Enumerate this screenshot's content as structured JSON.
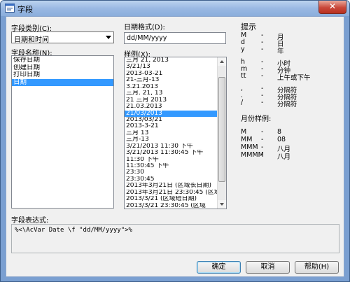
{
  "window": {
    "title": "字段",
    "close_glyph": "✕"
  },
  "category": {
    "label": "字段类别(C):",
    "value": "日期和时间"
  },
  "names": {
    "label": "字段名称(N):",
    "items": [
      "保存日期",
      "创建日期",
      "打印日期",
      "日期"
    ],
    "selected_index": 3
  },
  "format": {
    "label": "日期格式(D):",
    "value": "dd/MM/yyyy"
  },
  "samples": {
    "label": "样例(X):",
    "items": [
      "三月 21, 2013",
      "3/21/13",
      "2013-03-21",
      "21-三月-13",
      "3.21.2013",
      "三月. 21, 13",
      "21 三月 2013",
      "21.03.2013",
      "21/03/2013",
      "2013/03/21",
      "2013-3-21",
      "三月 13",
      "三月-13",
      "3/21/2013 11:30 下午",
      "3/21/2013 11:30:45 下午",
      "11:30 下午",
      "11:30:45 下午",
      "23:30",
      "23:30:45",
      "2013年3月21日 (区域长日期)",
      "2013年3月21日 23:30:45 (区域",
      "2013/3/21 (区域短日期)",
      "2013/3/21 23:30:45 (区域"
    ],
    "selected_index": 8
  },
  "hints": {
    "label": "提示",
    "rows": [
      {
        "key": "M",
        "dash": "-",
        "val": "月"
      },
      {
        "key": "d",
        "dash": "-",
        "val": "日"
      },
      {
        "key": "y",
        "dash": "-",
        "val": "年"
      },
      {
        "key": "h",
        "dash": "-",
        "val": "小时"
      },
      {
        "key": "m",
        "dash": "-",
        "val": "分钟"
      },
      {
        "key": "tt",
        "dash": "-",
        "val": "上午或下午"
      },
      {
        "key": ",",
        "dash": "-",
        "val": "分隔符"
      },
      {
        "key": ".",
        "dash": "-",
        "val": "分隔符"
      },
      {
        "key": "/",
        "dash": "-",
        "val": "分隔符"
      }
    ],
    "month_label": "月份样例:",
    "month_rows": [
      {
        "key": "M",
        "dash": "-",
        "val": "8"
      },
      {
        "key": "MM",
        "dash": "-",
        "val": "08"
      },
      {
        "key": "MMM",
        "dash": "-",
        "val": "八月"
      },
      {
        "key": "MMMM",
        "dash": "-",
        "val": "八月"
      }
    ]
  },
  "expression": {
    "label": "字段表达式:",
    "value": "%<\\AcVar Date \\f \"dd/MM/yyyy\">%"
  },
  "buttons": {
    "ok": "确定",
    "cancel": "取消",
    "help": "帮助(H)"
  }
}
